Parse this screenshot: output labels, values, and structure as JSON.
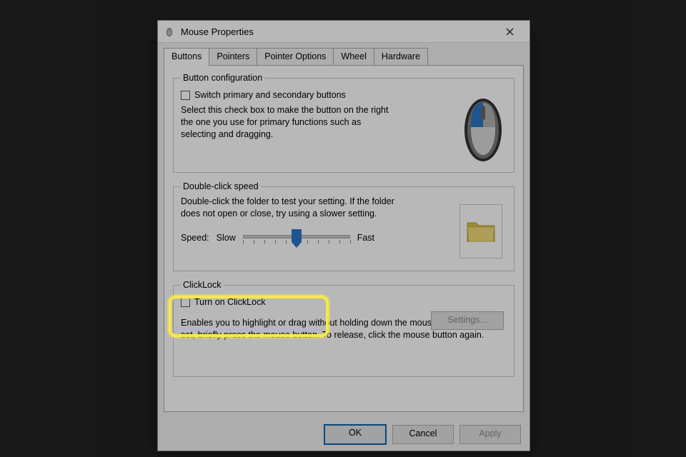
{
  "window": {
    "title": "Mouse Properties"
  },
  "tabs": [
    "Buttons",
    "Pointers",
    "Pointer Options",
    "Wheel",
    "Hardware"
  ],
  "active_tab_index": 0,
  "group_button_config": {
    "legend": "Button configuration",
    "checkbox_label": "Switch primary and secondary buttons",
    "checkbox_checked": false,
    "description": "Select this check box to make the button on the right the one you use for primary functions such as selecting and dragging."
  },
  "group_doubleclick": {
    "legend": "Double-click speed",
    "description": "Double-click the folder to test your setting. If the folder does not open or close, try using a slower setting.",
    "speed_label": "Speed:",
    "slow_label": "Slow",
    "fast_label": "Fast",
    "slider_value": 5,
    "slider_min": 0,
    "slider_max": 10
  },
  "group_clicklock": {
    "legend": "ClickLock",
    "checkbox_label": "Turn on ClickLock",
    "checkbox_checked": false,
    "settings_button": "Settings...",
    "settings_enabled": false,
    "description": "Enables you to highlight or drag without holding down the mouse button. To set, briefly press the mouse button. To release, click the mouse button again."
  },
  "footer": {
    "ok": "OK",
    "cancel": "Cancel",
    "apply": "Apply",
    "apply_enabled": false
  }
}
